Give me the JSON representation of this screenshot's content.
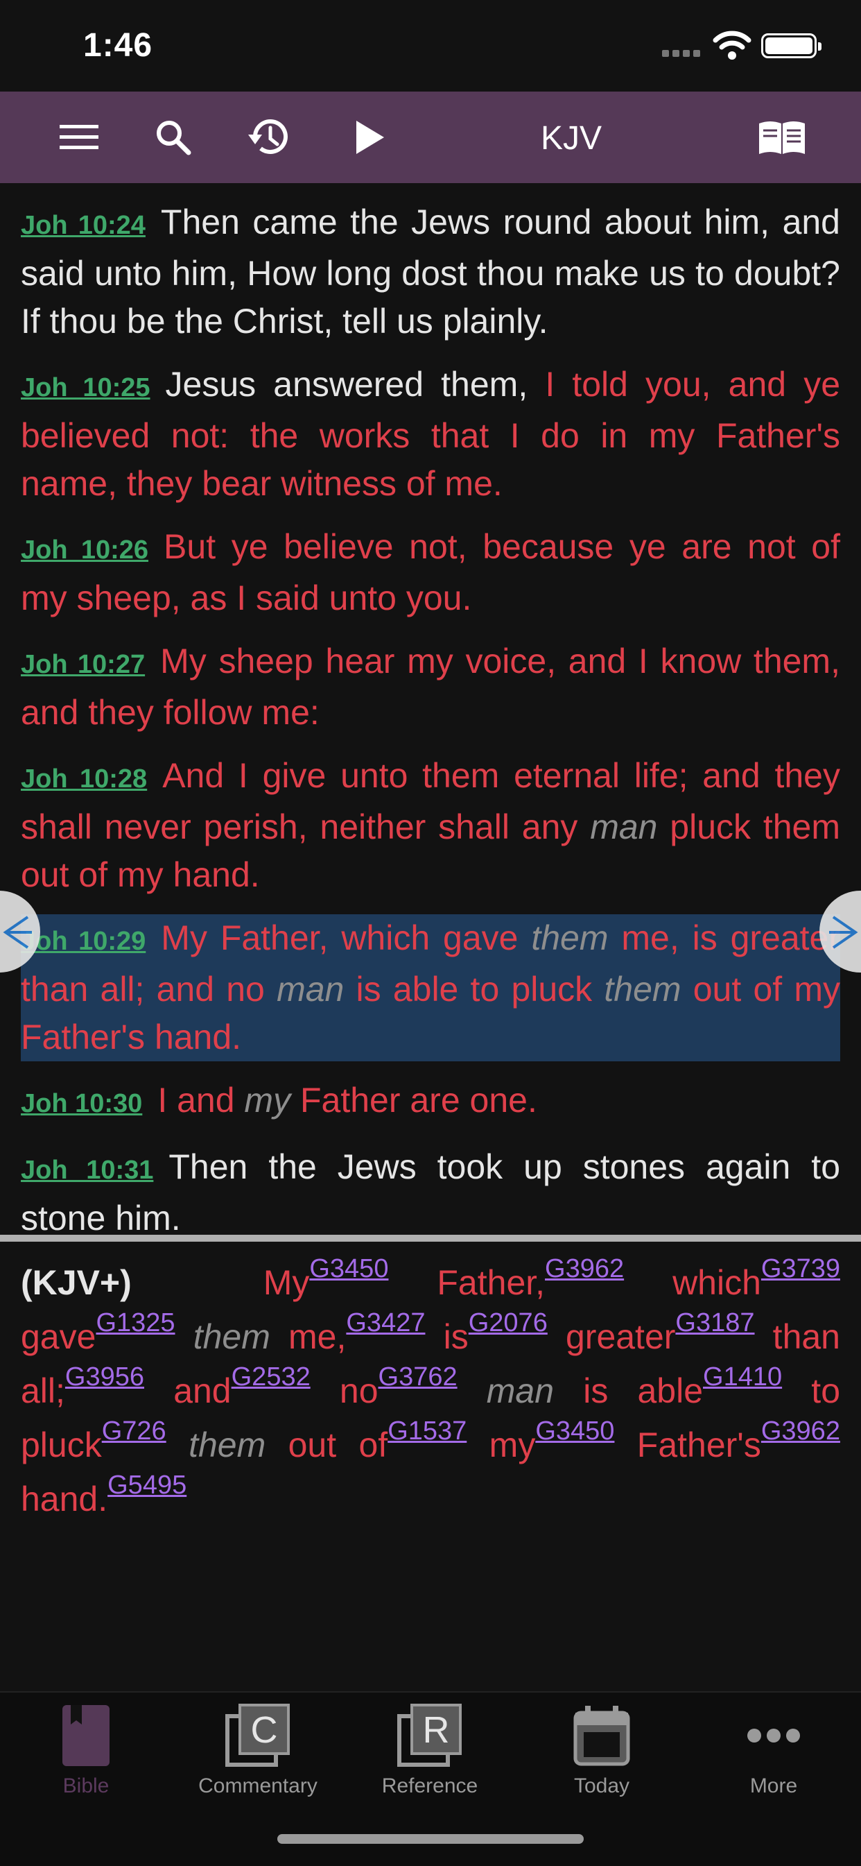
{
  "status_bar": {
    "time": "1:46"
  },
  "toolbar": {
    "title": "KJV",
    "icons": [
      "menu-icon",
      "search-icon",
      "history-icon",
      "play-icon",
      "book-icon"
    ]
  },
  "verses": [
    {
      "ref": "Joh 10:24",
      "parts": [
        {
          "t": "Then came the Jews round about him, and said unto him, How long dost thou make us to doubt? If thou be the Christ, tell us plainly.",
          "s": "white"
        }
      ]
    },
    {
      "ref": "Joh 10:25",
      "parts": [
        {
          "t": "Jesus answered them, ",
          "s": "white"
        },
        {
          "t": "I told you, and ye believed not: the works that I do in my Father's name, they bear witness of me.",
          "s": "red"
        }
      ]
    },
    {
      "ref": "Joh 10:26",
      "parts": [
        {
          "t": "But ye believe not, because ye are not of my sheep, as I said unto you.",
          "s": "red"
        }
      ]
    },
    {
      "ref": "Joh 10:27",
      "parts": [
        {
          "t": "My sheep hear my voice, and I know them, and they follow me:",
          "s": "red"
        }
      ]
    },
    {
      "ref": "Joh 10:28",
      "parts": [
        {
          "t": "And I give unto them eternal life; and they shall never perish, neither shall any ",
          "s": "red"
        },
        {
          "t": "man",
          "s": "it"
        },
        {
          "t": " pluck them out of my hand.",
          "s": "red"
        }
      ]
    },
    {
      "ref": "Joh 10:29",
      "highlight": true,
      "parts": [
        {
          "t": "My Father, which gave ",
          "s": "red"
        },
        {
          "t": "them",
          "s": "it"
        },
        {
          "t": " me, is greater than all; and no ",
          "s": "red"
        },
        {
          "t": "man",
          "s": "it"
        },
        {
          "t": " is able to pluck ",
          "s": "red"
        },
        {
          "t": "them",
          "s": "it"
        },
        {
          "t": " out of my Father's hand.",
          "s": "red"
        }
      ]
    },
    {
      "ref": "Joh 10:30",
      "parts": [
        {
          "t": "I and ",
          "s": "red"
        },
        {
          "t": "my",
          "s": "it"
        },
        {
          "t": " Father are one.",
          "s": "red"
        }
      ]
    },
    {
      "ref": "Joh 10:31",
      "parts": [
        {
          "t": "Then the Jews took up stones again to stone him.",
          "s": "white"
        }
      ]
    }
  ],
  "kjv_plus": {
    "label": "(KJV+)",
    "words": [
      {
        "w": "My",
        "g": "G3450"
      },
      {
        "w": "Father,",
        "g": "G3962"
      },
      {
        "w": "which",
        "g": "G3739"
      },
      {
        "w": "gave",
        "g": "G1325"
      },
      {
        "w": "them",
        "it": true
      },
      {
        "w": "me,",
        "g": "G3427"
      },
      {
        "w": "is",
        "g": "G2076"
      },
      {
        "w": "greater",
        "g": "G3187"
      },
      {
        "w": "than all;",
        "g": "G3956"
      },
      {
        "w": "and",
        "g": "G2532"
      },
      {
        "w": "no",
        "g": "G3762"
      },
      {
        "w": "man",
        "it": true
      },
      {
        "w": "is able",
        "g": "G1410"
      },
      {
        "w": "to pluck",
        "g": "G726"
      },
      {
        "w": "them",
        "it": true
      },
      {
        "w": "out of",
        "g": "G1537"
      },
      {
        "w": "my",
        "g": "G3450"
      },
      {
        "w": "Father's",
        "g": "G3962"
      },
      {
        "w": "hand.",
        "g": "G5495"
      }
    ]
  },
  "tabs": [
    {
      "label": "Bible",
      "icon": "bible-icon",
      "active": true
    },
    {
      "label": "Commentary",
      "icon": "commentary-icon"
    },
    {
      "label": "Reference",
      "icon": "reference-icon"
    },
    {
      "label": "Today",
      "icon": "calendar-icon"
    },
    {
      "label": "More",
      "icon": "more-icon"
    }
  ]
}
